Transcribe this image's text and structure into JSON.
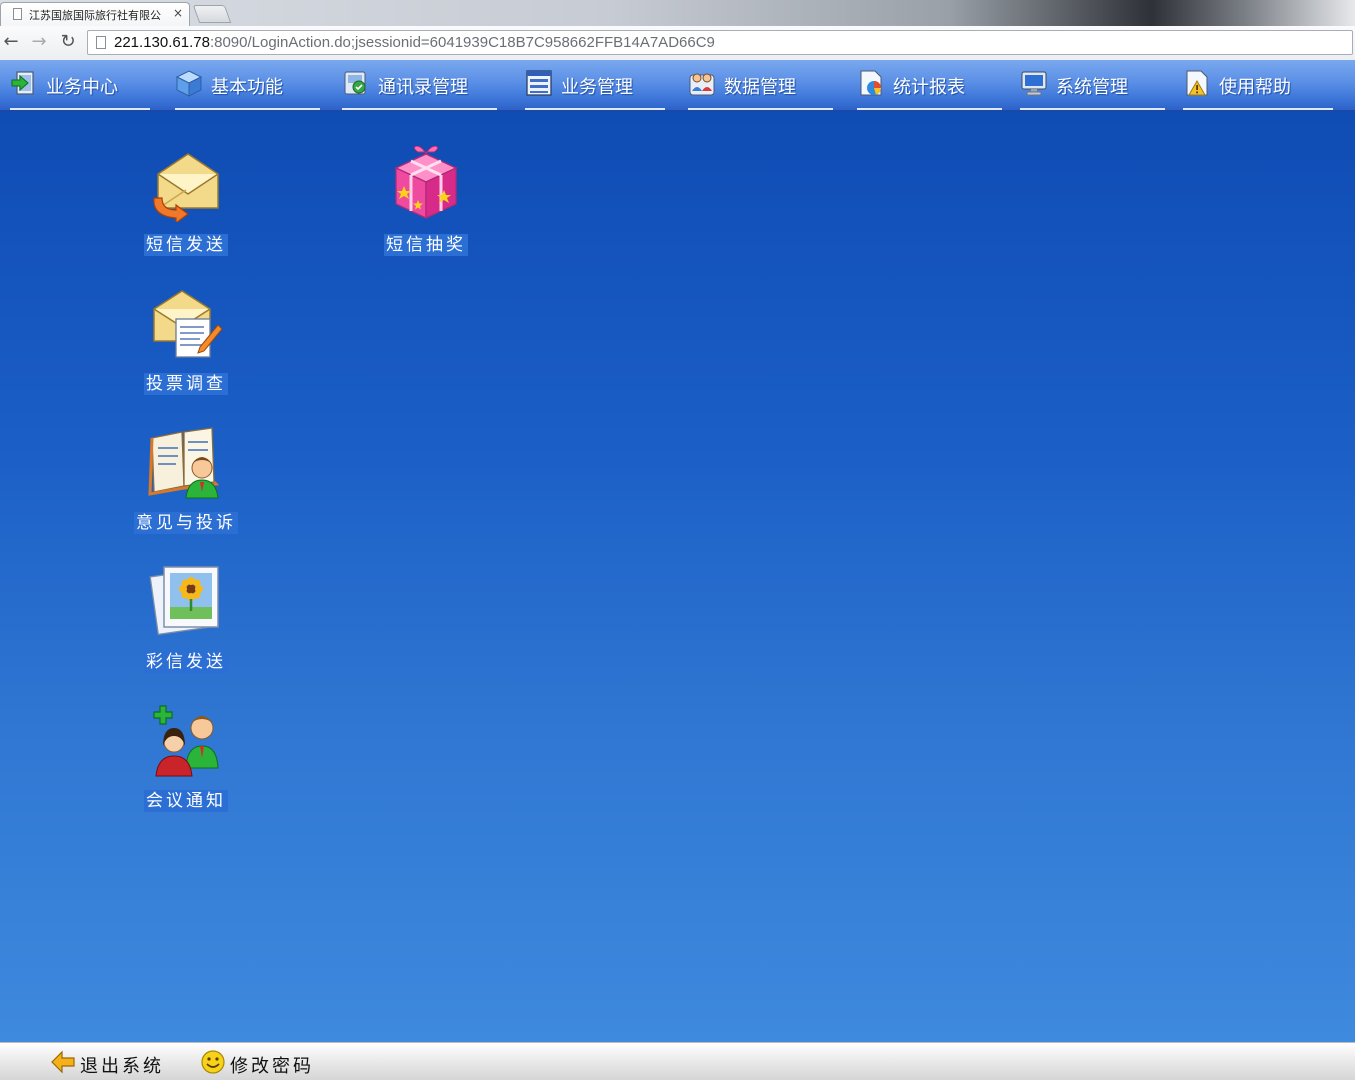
{
  "browser": {
    "tab_title": "江苏国旅国际旅行社有限公",
    "tab_close": "×",
    "url_host": "221.130.61.78",
    "url_rest": ":8090/LoginAction.do;jsessionid=6041939C18B7C958662FFB14A7AD66C9",
    "back_glyph": "←",
    "forward_glyph": "→",
    "reload_glyph": "↻"
  },
  "menu": [
    {
      "label": "业务中心",
      "icon": "business-center-icon"
    },
    {
      "label": "基本功能",
      "icon": "cube-icon"
    },
    {
      "label": "通讯录管理",
      "icon": "address-book-icon"
    },
    {
      "label": "业务管理",
      "icon": "list-window-icon"
    },
    {
      "label": "数据管理",
      "icon": "data-people-icon"
    },
    {
      "label": "统计报表",
      "icon": "report-chart-icon"
    },
    {
      "label": "系统管理",
      "icon": "monitor-icon"
    },
    {
      "label": "使用帮助",
      "icon": "help-document-icon"
    }
  ],
  "desktop": {
    "items": [
      {
        "label": "短信发送",
        "icon": "sms-send-envelope-icon"
      },
      {
        "label": "投票调查",
        "icon": "vote-survey-envelope-icon"
      },
      {
        "label": "意见与投诉",
        "icon": "feedback-book-person-icon"
      },
      {
        "label": "彩信发送",
        "icon": "mms-photo-icon"
      },
      {
        "label": "会议通知",
        "icon": "meeting-people-icon"
      },
      {
        "label": "短信抽奖",
        "icon": "gift-box-icon"
      }
    ]
  },
  "bottom": {
    "logout_label": "退出系统",
    "change_password_label": "修改密码"
  },
  "colors": {
    "menu_gradient_top": "#7aa8ee",
    "menu_gradient_bottom": "#2d62c9",
    "desktop_top": "#0f4cb4",
    "desktop_bottom": "#3e8ade",
    "label_bg": "#2c6fd4"
  }
}
